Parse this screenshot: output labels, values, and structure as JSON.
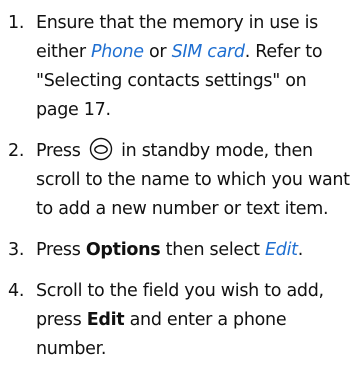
{
  "accent_color": "#1f6fd1",
  "steps": [
    {
      "number": "1.",
      "parts": [
        "Ensure that the memory in use is either ",
        "Phone",
        " or ",
        "SIM card",
        ". Refer to \"Selecting contacts settings\" on page 17."
      ]
    },
    {
      "number": "2.",
      "icon": "navigation-key-icon",
      "parts": [
        "Press ",
        " in standby mode, then scroll to the name to which you want to add a new number or text item."
      ]
    },
    {
      "number": "3.",
      "parts": [
        "Press ",
        "Options",
        " then select ",
        "Edit",
        "."
      ]
    },
    {
      "number": "4.",
      "parts": [
        "Scroll to the field you wish to add, press ",
        "Edit",
        " and enter a phone number."
      ]
    }
  ]
}
